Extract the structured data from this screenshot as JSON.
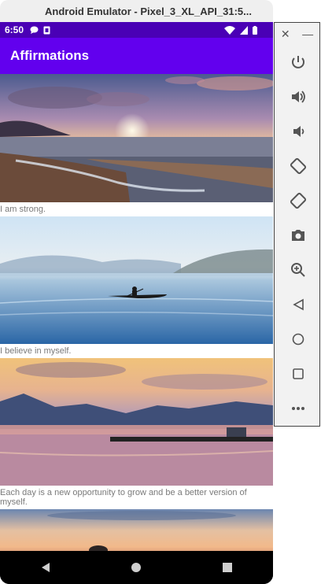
{
  "window": {
    "title": "Android Emulator - Pixel_3_XL_API_31:5..."
  },
  "status_bar": {
    "time": "6:50",
    "icons": [
      "chat-icon",
      "sim-icon",
      "wifi-icon",
      "signal-icon",
      "battery-icon"
    ]
  },
  "app_bar": {
    "title": "Affirmations"
  },
  "affirmations": [
    {
      "text": "I am strong.",
      "image": "beach-sunset-photo"
    },
    {
      "text": "I believe in myself.",
      "image": "kayak-lake-photo"
    },
    {
      "text": "Each day is a new opportunity to grow and be a better version of myself.",
      "image": "mountain-lake-dusk-photo"
    },
    {
      "text": "",
      "image": "sunset-rock-photo"
    }
  ],
  "nav_bar": {
    "buttons": [
      "back-icon",
      "home-icon",
      "overview-icon"
    ]
  },
  "emulator_toolbar": {
    "top": [
      "close-icon",
      "minimize-icon"
    ],
    "buttons": [
      "power-icon",
      "volume-up-icon",
      "volume-down-icon",
      "rotate-left-icon",
      "rotate-right-icon",
      "camera-icon",
      "zoom-icon",
      "back-icon",
      "home-icon",
      "overview-icon",
      "more-icon"
    ]
  },
  "colors": {
    "status_bar": "#4a00b5",
    "app_bar": "#6200ee",
    "caption": "#7a7a7a"
  }
}
